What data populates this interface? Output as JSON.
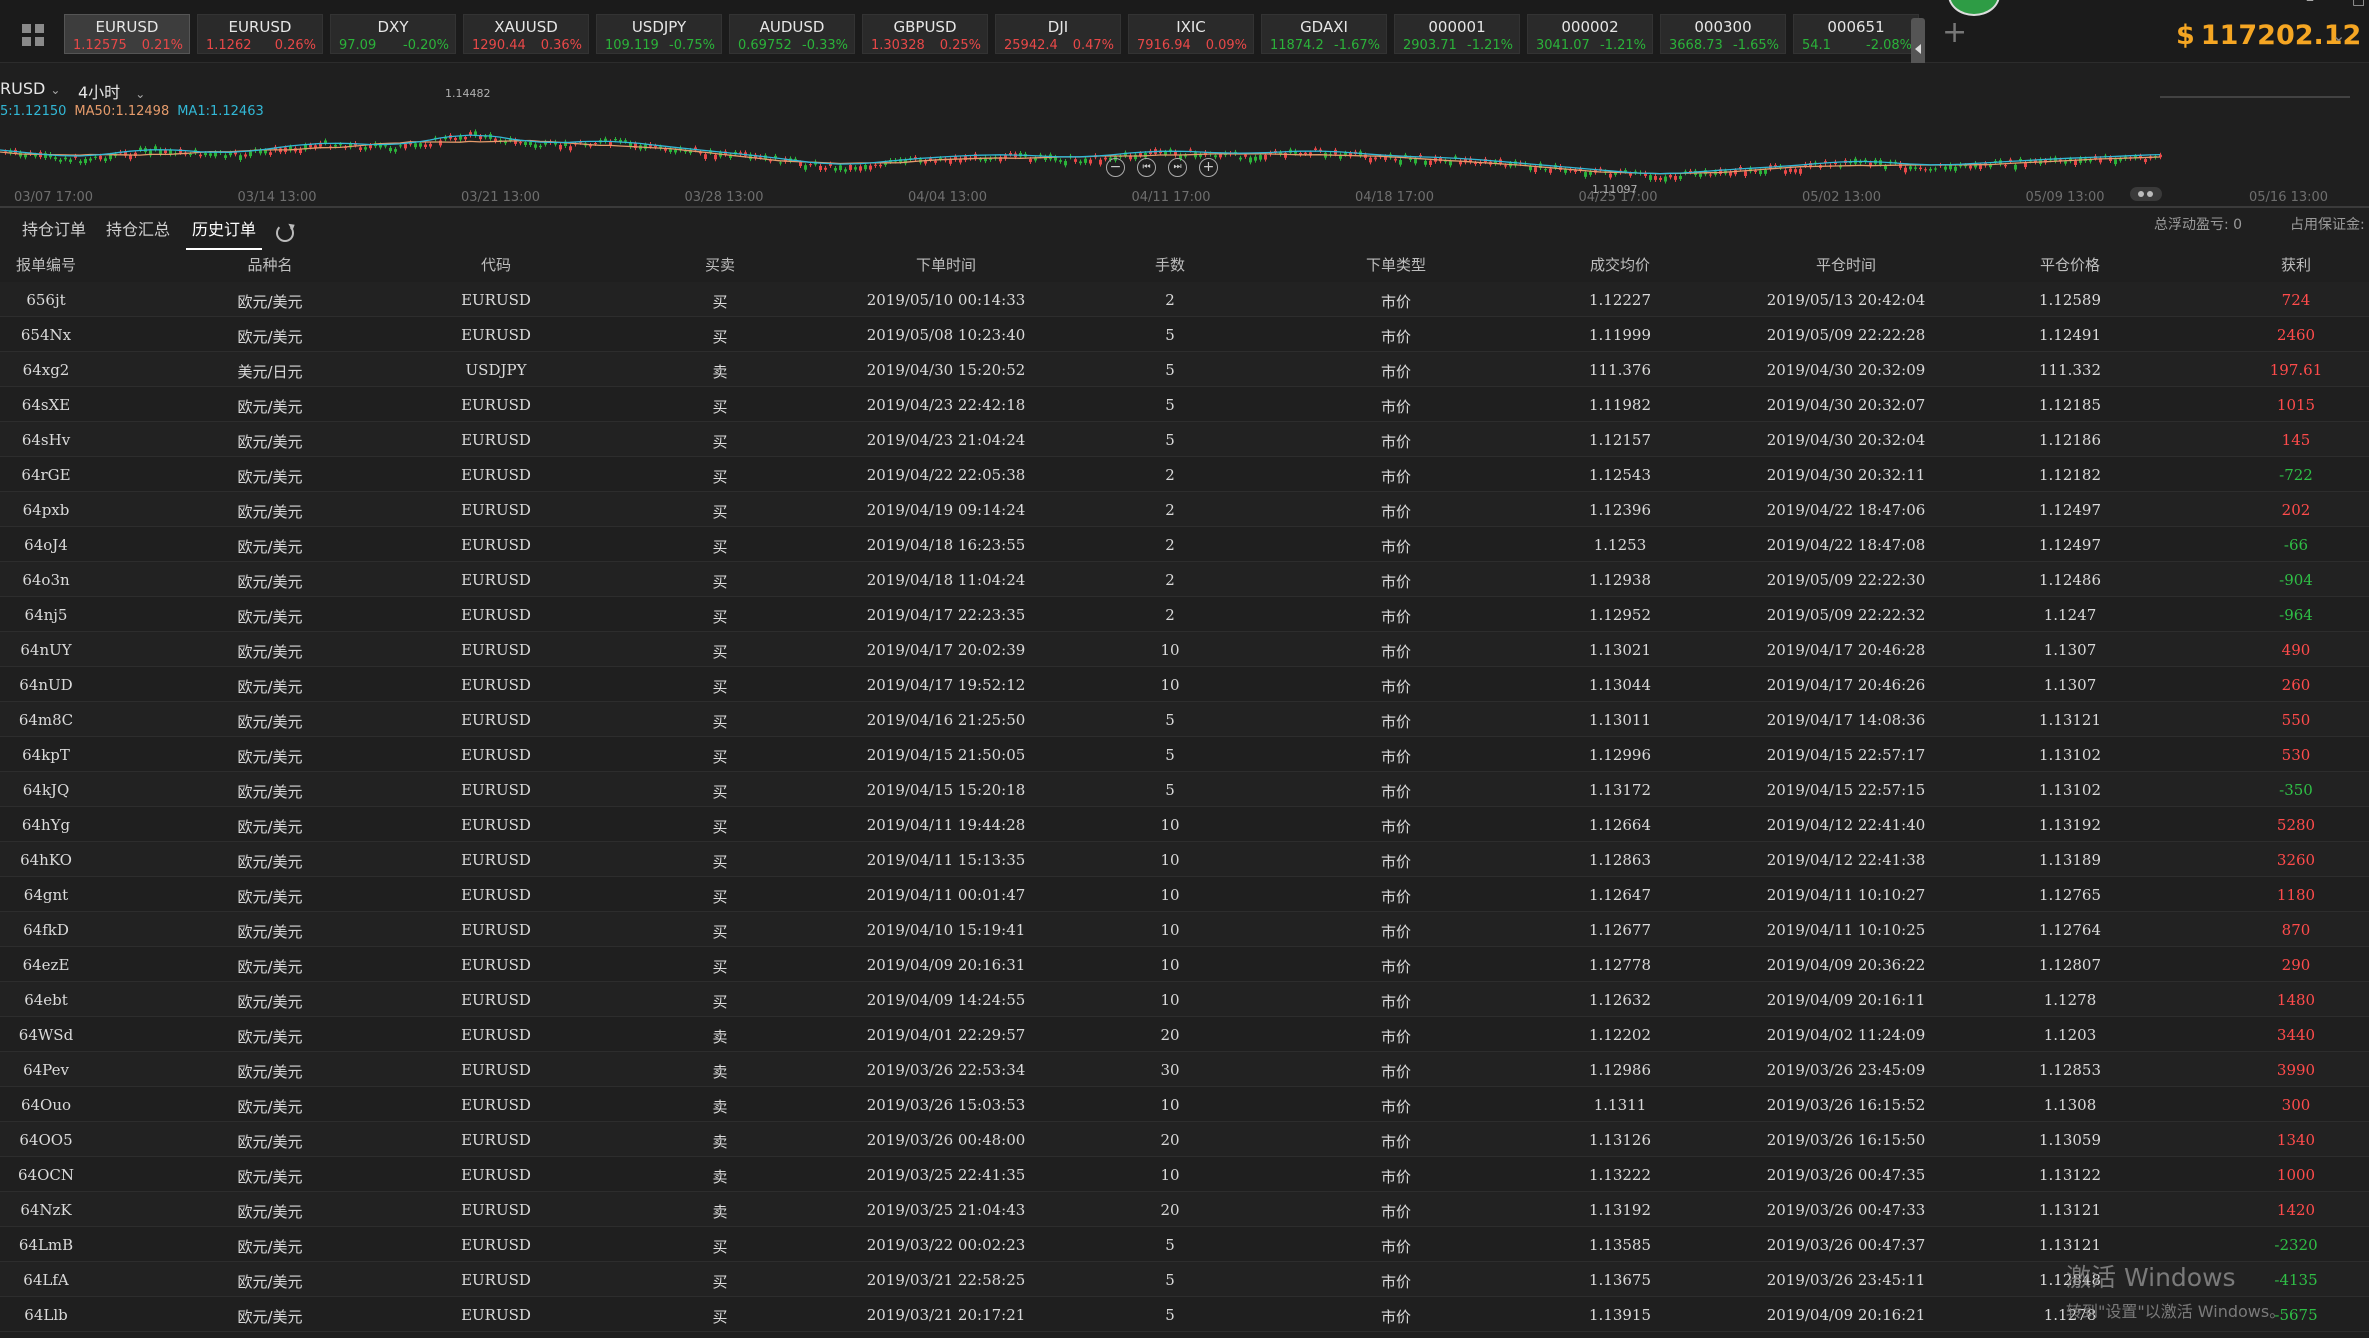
{
  "tickers": [
    {
      "symbol": "EURUSD",
      "price": "1.12575",
      "change": "0.21%",
      "dir": "up",
      "active": true
    },
    {
      "symbol": "EURUSD",
      "price": "1.1262",
      "change": "0.26%",
      "dir": "up",
      "active": false
    },
    {
      "symbol": "DXY",
      "price": "97.09",
      "change": "-0.20%",
      "dir": "down",
      "active": false
    },
    {
      "symbol": "XAUUSD",
      "price": "1290.44",
      "change": "0.36%",
      "dir": "up",
      "active": false
    },
    {
      "symbol": "USDJPY",
      "price": "109.119",
      "change": "-0.75%",
      "dir": "down",
      "active": false
    },
    {
      "symbol": "AUDUSD",
      "price": "0.69752",
      "change": "-0.33%",
      "dir": "down",
      "active": false
    },
    {
      "symbol": "GBPUSD",
      "price": "1.30328",
      "change": "0.25%",
      "dir": "up",
      "active": false
    },
    {
      "symbol": "DJI",
      "price": "25942.4",
      "change": "0.47%",
      "dir": "up",
      "active": false
    },
    {
      "symbol": "IXIC",
      "price": "7916.94",
      "change": "0.09%",
      "dir": "up",
      "active": false
    },
    {
      "symbol": "GDAXI",
      "price": "11874.2",
      "change": "-1.67%",
      "dir": "down",
      "active": false
    },
    {
      "symbol": "000001",
      "price": "2903.71",
      "change": "-1.21%",
      "dir": "down",
      "active": false
    },
    {
      "symbol": "000002",
      "price": "3041.07",
      "change": "-1.21%",
      "dir": "down",
      "active": false
    },
    {
      "symbol": "000300",
      "price": "3668.73",
      "change": "-1.65%",
      "dir": "down",
      "active": false
    },
    {
      "symbol": "000651",
      "price": "54.1",
      "change": "-2.08%",
      "dir": "down",
      "active": false
    }
  ],
  "balance": {
    "currency": "$",
    "amount": "117202.12"
  },
  "chart": {
    "symbol": "RUSD",
    "timeframe": "4小时",
    "ma": {
      "ma_a": "5:1.12150",
      "ma_b": "MA50:1.12498",
      "ma_c": "MA1:1.12463"
    },
    "high_label": "1.14482",
    "low_label": "1.11097",
    "dates": [
      "03/07 17:00",
      "03/14 13:00",
      "03/21 13:00",
      "03/28 13:00",
      "04/04 13:00",
      "04/11 17:00",
      "04/18 17:00",
      "04/25 17:00",
      "05/02 13:00",
      "05/09 13:00",
      "05/16 13:00"
    ],
    "colors": {
      "up": "#e84848",
      "down": "#2bb33a",
      "ma_a": "#32b8d6",
      "ma_b": "#e59b6b"
    }
  },
  "tabs": [
    "持仓订单",
    "持仓汇总",
    "历史订单"
  ],
  "active_tab": "历史订单",
  "summary": {
    "floating": "总浮动盈亏: 0",
    "margin": "占用保证金:"
  },
  "columns": [
    "报单编号",
    "品种名",
    "代码",
    "买卖",
    "下单时间",
    "手数",
    "下单类型",
    "成交均价",
    "平仓时间",
    "平仓价格",
    "获利"
  ],
  "orders": [
    {
      "id": "656jt",
      "name": "欧元/美元",
      "code": "EURUSD",
      "side": "买",
      "open_time": "2019/05/10 00:14:33",
      "lots": "2",
      "type": "市价",
      "avg_price": "1.12227",
      "close_time": "2019/05/13 20:42:04",
      "close_price": "1.12589",
      "profit": "724"
    },
    {
      "id": "654Nx",
      "name": "欧元/美元",
      "code": "EURUSD",
      "side": "买",
      "open_time": "2019/05/08 10:23:40",
      "lots": "5",
      "type": "市价",
      "avg_price": "1.11999",
      "close_time": "2019/05/09 22:22:28",
      "close_price": "1.12491",
      "profit": "2460"
    },
    {
      "id": "64xg2",
      "name": "美元/日元",
      "code": "USDJPY",
      "side": "卖",
      "open_time": "2019/04/30 15:20:52",
      "lots": "5",
      "type": "市价",
      "avg_price": "111.376",
      "close_time": "2019/04/30 20:32:09",
      "close_price": "111.332",
      "profit": "197.61"
    },
    {
      "id": "64sXE",
      "name": "欧元/美元",
      "code": "EURUSD",
      "side": "买",
      "open_time": "2019/04/23 22:42:18",
      "lots": "5",
      "type": "市价",
      "avg_price": "1.11982",
      "close_time": "2019/04/30 20:32:07",
      "close_price": "1.12185",
      "profit": "1015"
    },
    {
      "id": "64sHv",
      "name": "欧元/美元",
      "code": "EURUSD",
      "side": "买",
      "open_time": "2019/04/23 21:04:24",
      "lots": "5",
      "type": "市价",
      "avg_price": "1.12157",
      "close_time": "2019/04/30 20:32:04",
      "close_price": "1.12186",
      "profit": "145"
    },
    {
      "id": "64rGE",
      "name": "欧元/美元",
      "code": "EURUSD",
      "side": "买",
      "open_time": "2019/04/22 22:05:38",
      "lots": "2",
      "type": "市价",
      "avg_price": "1.12543",
      "close_time": "2019/04/30 20:32:11",
      "close_price": "1.12182",
      "profit": "-722"
    },
    {
      "id": "64pxb",
      "name": "欧元/美元",
      "code": "EURUSD",
      "side": "买",
      "open_time": "2019/04/19 09:14:24",
      "lots": "2",
      "type": "市价",
      "avg_price": "1.12396",
      "close_time": "2019/04/22 18:47:06",
      "close_price": "1.12497",
      "profit": "202"
    },
    {
      "id": "64oJ4",
      "name": "欧元/美元",
      "code": "EURUSD",
      "side": "买",
      "open_time": "2019/04/18 16:23:55",
      "lots": "2",
      "type": "市价",
      "avg_price": "1.1253",
      "close_time": "2019/04/22 18:47:08",
      "close_price": "1.12497",
      "profit": "-66"
    },
    {
      "id": "64o3n",
      "name": "欧元/美元",
      "code": "EURUSD",
      "side": "买",
      "open_time": "2019/04/18 11:04:24",
      "lots": "2",
      "type": "市价",
      "avg_price": "1.12938",
      "close_time": "2019/05/09 22:22:30",
      "close_price": "1.12486",
      "profit": "-904"
    },
    {
      "id": "64nj5",
      "name": "欧元/美元",
      "code": "EURUSD",
      "side": "买",
      "open_time": "2019/04/17 22:23:35",
      "lots": "2",
      "type": "市价",
      "avg_price": "1.12952",
      "close_time": "2019/05/09 22:22:32",
      "close_price": "1.1247",
      "profit": "-964"
    },
    {
      "id": "64nUY",
      "name": "欧元/美元",
      "code": "EURUSD",
      "side": "买",
      "open_time": "2019/04/17 20:02:39",
      "lots": "10",
      "type": "市价",
      "avg_price": "1.13021",
      "close_time": "2019/04/17 20:46:28",
      "close_price": "1.1307",
      "profit": "490"
    },
    {
      "id": "64nUD",
      "name": "欧元/美元",
      "code": "EURUSD",
      "side": "买",
      "open_time": "2019/04/17 19:52:12",
      "lots": "10",
      "type": "市价",
      "avg_price": "1.13044",
      "close_time": "2019/04/17 20:46:26",
      "close_price": "1.1307",
      "profit": "260"
    },
    {
      "id": "64m8C",
      "name": "欧元/美元",
      "code": "EURUSD",
      "side": "买",
      "open_time": "2019/04/16 21:25:50",
      "lots": "5",
      "type": "市价",
      "avg_price": "1.13011",
      "close_time": "2019/04/17 14:08:36",
      "close_price": "1.13121",
      "profit": "550"
    },
    {
      "id": "64kpT",
      "name": "欧元/美元",
      "code": "EURUSD",
      "side": "买",
      "open_time": "2019/04/15 21:50:05",
      "lots": "5",
      "type": "市价",
      "avg_price": "1.12996",
      "close_time": "2019/04/15 22:57:17",
      "close_price": "1.13102",
      "profit": "530"
    },
    {
      "id": "64kJQ",
      "name": "欧元/美元",
      "code": "EURUSD",
      "side": "买",
      "open_time": "2019/04/15 15:20:18",
      "lots": "5",
      "type": "市价",
      "avg_price": "1.13172",
      "close_time": "2019/04/15 22:57:15",
      "close_price": "1.13102",
      "profit": "-350"
    },
    {
      "id": "64hYg",
      "name": "欧元/美元",
      "code": "EURUSD",
      "side": "买",
      "open_time": "2019/04/11 19:44:28",
      "lots": "10",
      "type": "市价",
      "avg_price": "1.12664",
      "close_time": "2019/04/12 22:41:40",
      "close_price": "1.13192",
      "profit": "5280"
    },
    {
      "id": "64hKO",
      "name": "欧元/美元",
      "code": "EURUSD",
      "side": "买",
      "open_time": "2019/04/11 15:13:35",
      "lots": "10",
      "type": "市价",
      "avg_price": "1.12863",
      "close_time": "2019/04/12 22:41:38",
      "close_price": "1.13189",
      "profit": "3260"
    },
    {
      "id": "64gnt",
      "name": "欧元/美元",
      "code": "EURUSD",
      "side": "买",
      "open_time": "2019/04/11 00:01:47",
      "lots": "10",
      "type": "市价",
      "avg_price": "1.12647",
      "close_time": "2019/04/11 10:10:27",
      "close_price": "1.12765",
      "profit": "1180"
    },
    {
      "id": "64fkD",
      "name": "欧元/美元",
      "code": "EURUSD",
      "side": "买",
      "open_time": "2019/04/10 15:19:41",
      "lots": "10",
      "type": "市价",
      "avg_price": "1.12677",
      "close_time": "2019/04/11 10:10:25",
      "close_price": "1.12764",
      "profit": "870"
    },
    {
      "id": "64ezE",
      "name": "欧元/美元",
      "code": "EURUSD",
      "side": "买",
      "open_time": "2019/04/09 20:16:31",
      "lots": "10",
      "type": "市价",
      "avg_price": "1.12778",
      "close_time": "2019/04/09 20:36:22",
      "close_price": "1.12807",
      "profit": "290"
    },
    {
      "id": "64ebt",
      "name": "欧元/美元",
      "code": "EURUSD",
      "side": "买",
      "open_time": "2019/04/09 14:24:55",
      "lots": "10",
      "type": "市价",
      "avg_price": "1.12632",
      "close_time": "2019/04/09 20:16:11",
      "close_price": "1.1278",
      "profit": "1480"
    },
    {
      "id": "64WSd",
      "name": "欧元/美元",
      "code": "EURUSD",
      "side": "卖",
      "open_time": "2019/04/01 22:29:57",
      "lots": "20",
      "type": "市价",
      "avg_price": "1.12202",
      "close_time": "2019/04/02 11:24:09",
      "close_price": "1.1203",
      "profit": "3440"
    },
    {
      "id": "64Pev",
      "name": "欧元/美元",
      "code": "EURUSD",
      "side": "卖",
      "open_time": "2019/03/26 22:53:34",
      "lots": "30",
      "type": "市价",
      "avg_price": "1.12986",
      "close_time": "2019/03/26 23:45:09",
      "close_price": "1.12853",
      "profit": "3990"
    },
    {
      "id": "64Ouo",
      "name": "欧元/美元",
      "code": "EURUSD",
      "side": "卖",
      "open_time": "2019/03/26 15:03:53",
      "lots": "10",
      "type": "市价",
      "avg_price": "1.1311",
      "close_time": "2019/03/26 16:15:52",
      "close_price": "1.1308",
      "profit": "300"
    },
    {
      "id": "64OO5",
      "name": "欧元/美元",
      "code": "EURUSD",
      "side": "卖",
      "open_time": "2019/03/26 00:48:00",
      "lots": "20",
      "type": "市价",
      "avg_price": "1.13126",
      "close_time": "2019/03/26 16:15:50",
      "close_price": "1.13059",
      "profit": "1340"
    },
    {
      "id": "64OCN",
      "name": "欧元/美元",
      "code": "EURUSD",
      "side": "卖",
      "open_time": "2019/03/25 22:41:35",
      "lots": "10",
      "type": "市价",
      "avg_price": "1.13222",
      "close_time": "2019/03/26 00:47:35",
      "close_price": "1.13122",
      "profit": "1000"
    },
    {
      "id": "64NzK",
      "name": "欧元/美元",
      "code": "EURUSD",
      "side": "卖",
      "open_time": "2019/03/25 21:04:43",
      "lots": "20",
      "type": "市价",
      "avg_price": "1.13192",
      "close_time": "2019/03/26 00:47:33",
      "close_price": "1.13121",
      "profit": "1420"
    },
    {
      "id": "64LmB",
      "name": "欧元/美元",
      "code": "EURUSD",
      "side": "买",
      "open_time": "2019/03/22 00:02:23",
      "lots": "5",
      "type": "市价",
      "avg_price": "1.13585",
      "close_time": "2019/03/26 00:47:37",
      "close_price": "1.13121",
      "profit": "-2320"
    },
    {
      "id": "64LfA",
      "name": "欧元/美元",
      "code": "EURUSD",
      "side": "买",
      "open_time": "2019/03/21 22:58:25",
      "lots": "5",
      "type": "市价",
      "avg_price": "1.13675",
      "close_time": "2019/03/26 23:45:11",
      "close_price": "1.12848",
      "profit": "-4135"
    },
    {
      "id": "64Llb",
      "name": "欧元/美元",
      "code": "EURUSD",
      "side": "买",
      "open_time": "2019/03/21 20:17:21",
      "lots": "5",
      "type": "市价",
      "avg_price": "1.13915",
      "close_time": "2019/04/09 20:16:21",
      "close_price": "1.1278",
      "profit": "-5675"
    }
  ],
  "watermark": {
    "line1": "激活 Windows",
    "line2": "转到\"设置\"以激活 Windows。"
  }
}
